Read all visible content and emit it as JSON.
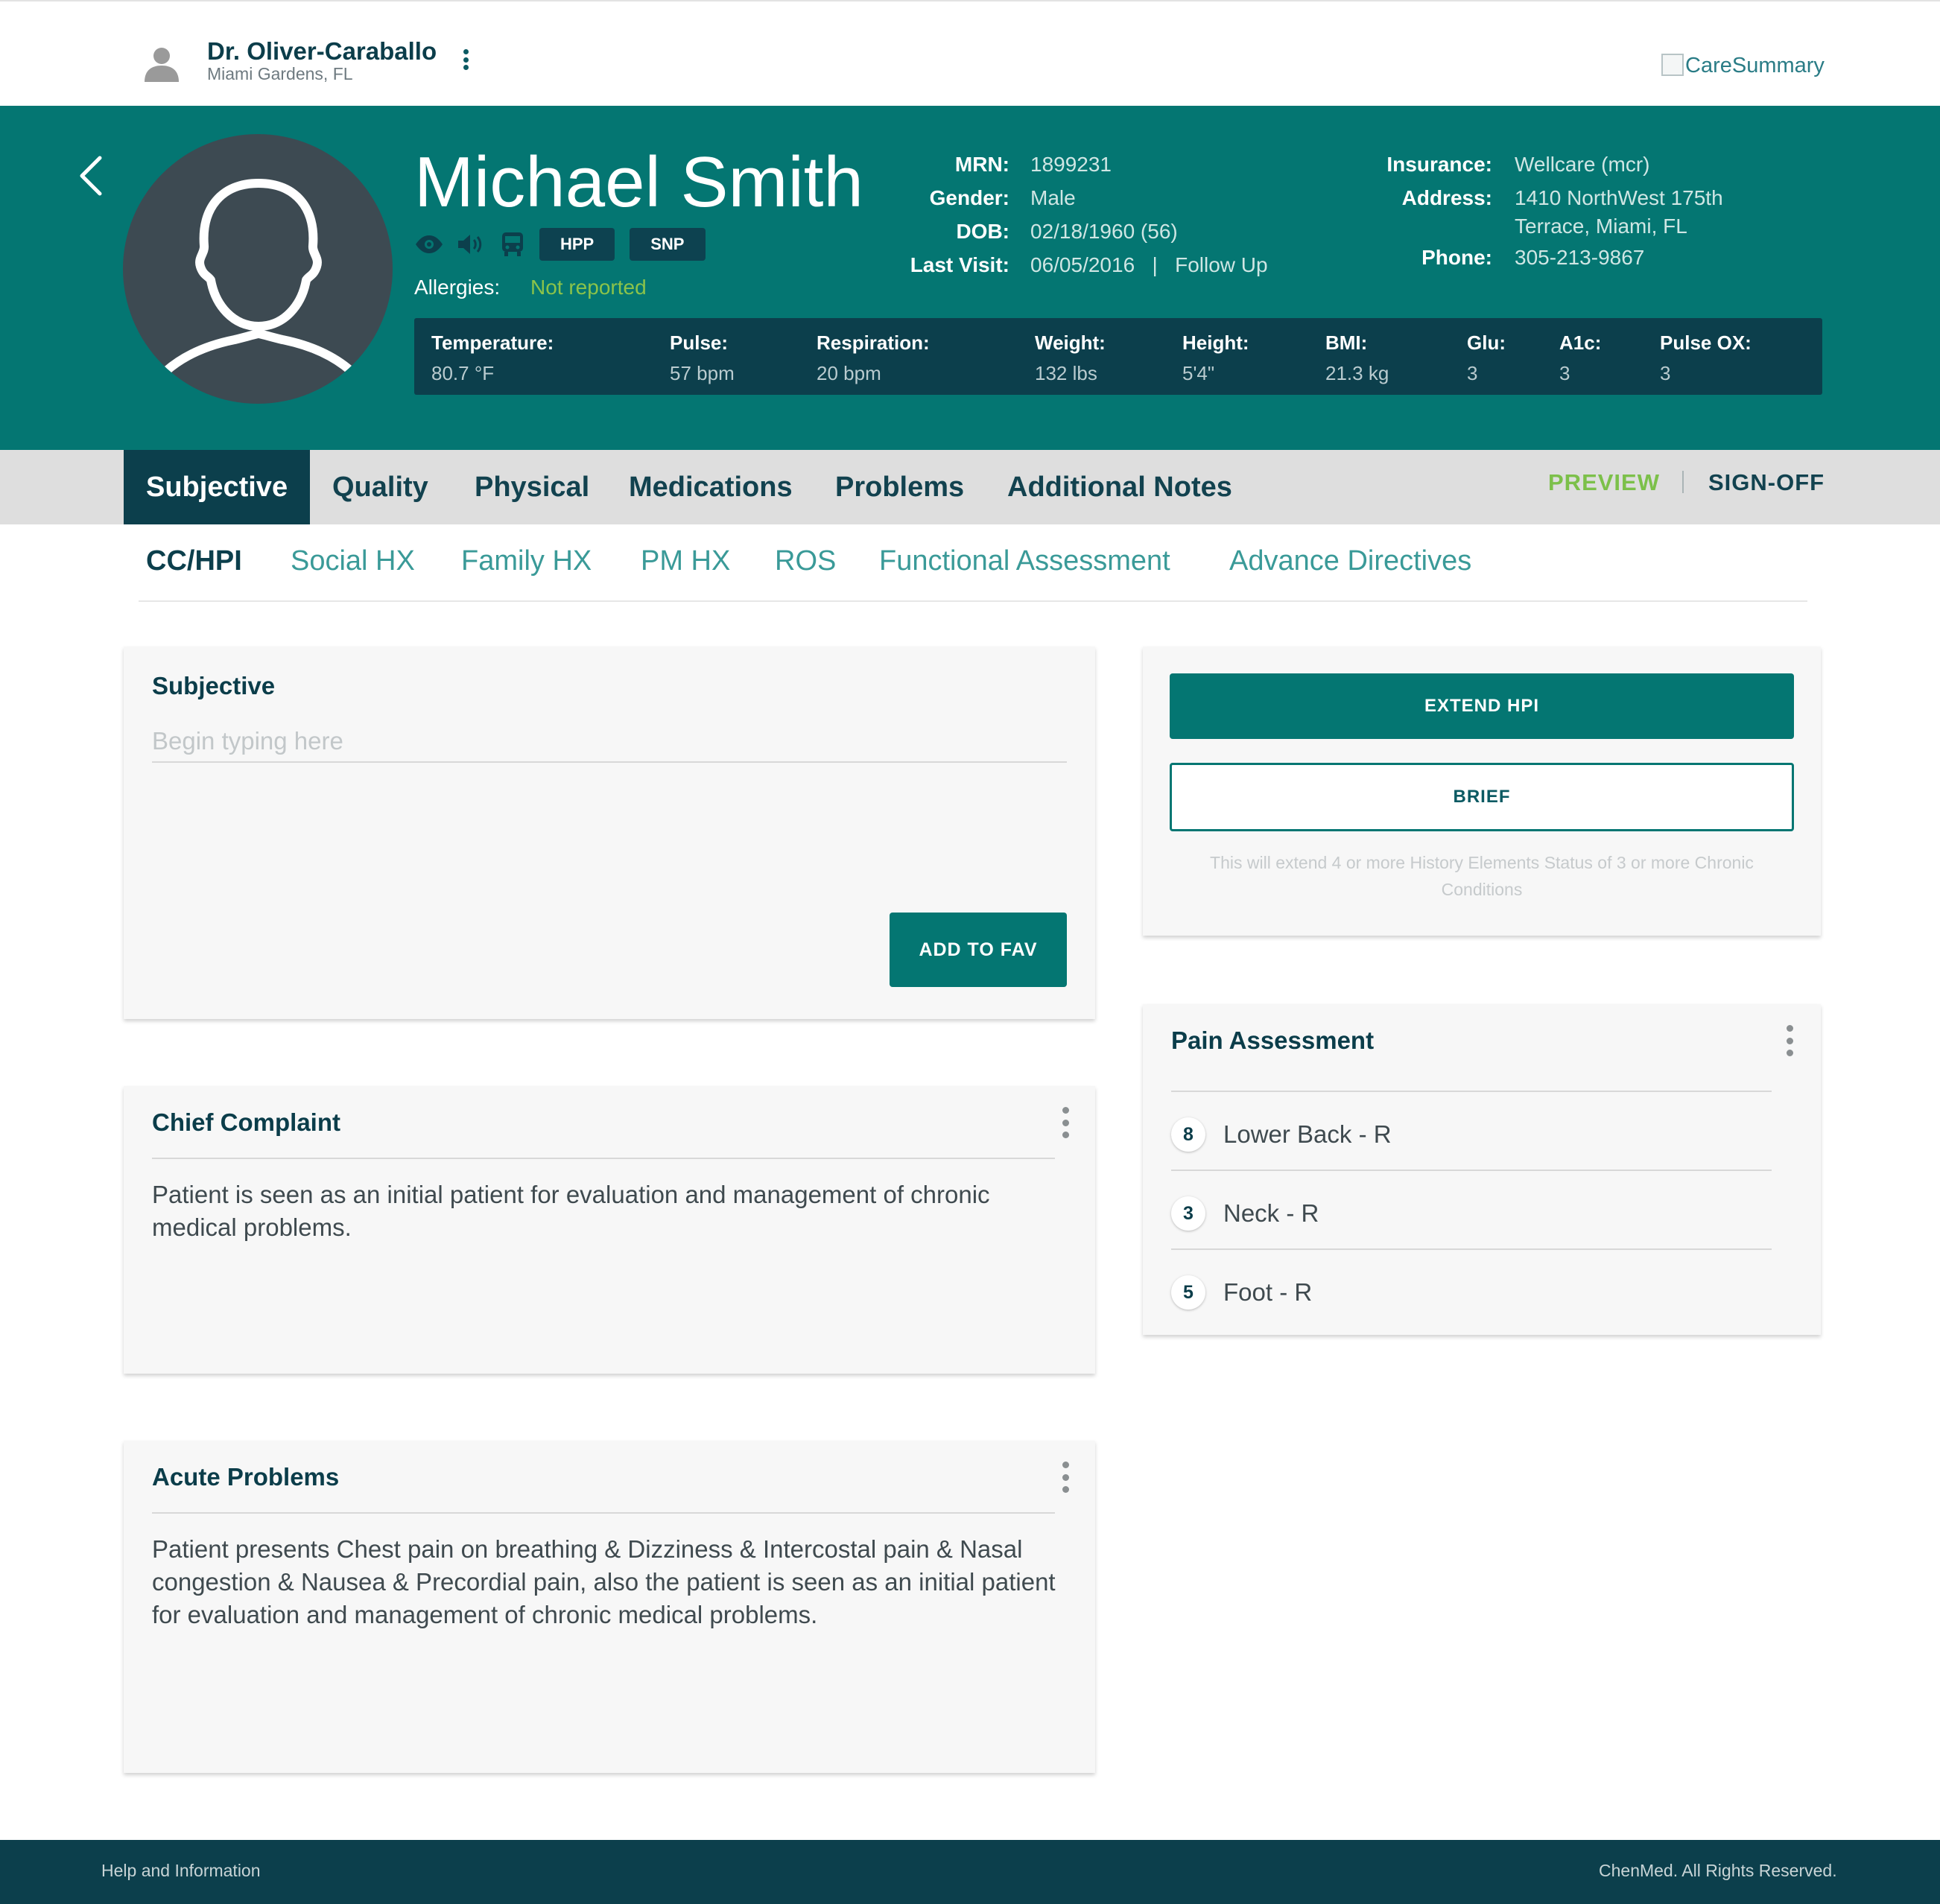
{
  "header": {
    "doctor_name": "Dr. Oliver-Caraballo",
    "doctor_location": "Miami Gardens, FL",
    "brand": "CareSummary"
  },
  "patient": {
    "name": "Michael Smith",
    "tags": [
      "HPP",
      "SNP"
    ],
    "icons": [
      "eye-icon",
      "volume-icon",
      "bus-icon"
    ],
    "allergies_label": "Allergies:",
    "allergies_value": "Not reported",
    "info_left": [
      {
        "label": "MRN:",
        "value": "1899231"
      },
      {
        "label": "Gender:",
        "value": "Male"
      },
      {
        "label": "DOB:",
        "value": "02/18/1960 (56)"
      },
      {
        "label": "Last Visit:",
        "value": "06/05/2016   |   Follow Up"
      }
    ],
    "info_right": [
      {
        "label": "Insurance:",
        "value": "Wellcare (mcr)"
      },
      {
        "label": "Address:",
        "value_line1": "1410 NorthWest 175th",
        "value_line2": "Terrace, Miami, FL"
      },
      {
        "label": "Phone:",
        "value": "305-213-9867"
      }
    ],
    "vitals": [
      {
        "label": "Temperature:",
        "value": "80.7 °F"
      },
      {
        "label": "Pulse:",
        "value": "57 bpm"
      },
      {
        "label": "Respiration:",
        "value": "20 bpm"
      },
      {
        "label": "Weight:",
        "value": "132 lbs"
      },
      {
        "label": "Height:",
        "value": "5'4\""
      },
      {
        "label": "BMI:",
        "value": "21.3 kg"
      },
      {
        "label": "Glu:",
        "value": "3"
      },
      {
        "label": "A1c:",
        "value": "3"
      },
      {
        "label": "Pulse OX:",
        "value": "3"
      }
    ]
  },
  "tabs": {
    "main": [
      "Subjective",
      "Quality",
      "Physical",
      "Medications",
      "Problems",
      "Additional Notes"
    ],
    "active_main": "Subjective",
    "preview": "PREVIEW",
    "signoff": "SIGN-OFF",
    "sub": [
      "CC/HPI",
      "Social HX",
      "Family HX",
      "PM HX",
      "ROS",
      "Functional Assessment",
      "Advance Directives"
    ],
    "active_sub": "CC/HPI"
  },
  "subjective_card": {
    "title": "Subjective",
    "placeholder": "Begin typing here",
    "value": "",
    "fav_button": "ADD TO FAV"
  },
  "hpi_card": {
    "extend_button": "EXTEND HPI",
    "brief_button": "BRIEF",
    "note": "This will extend 4 or more History Elements Status of 3 or more Chronic Conditions"
  },
  "chief_complaint": {
    "title": "Chief Complaint",
    "text": "Patient is seen as an initial patient for evaluation and management of chronic medical problems."
  },
  "acute_problems": {
    "title": "Acute Problems",
    "text": "Patient presents Chest pain on breathing & Dizziness & Intercostal pain & Nasal congestion & Nausea & Precordial pain, also the patient is seen as an initial patient for evaluation and management of chronic medical problems."
  },
  "pain_assessment": {
    "title": "Pain Assessment",
    "items": [
      {
        "score": "8",
        "label": "Lower Back - R"
      },
      {
        "score": "3",
        "label": "Neck - R"
      },
      {
        "score": "5",
        "label": "Foot - R"
      }
    ]
  },
  "footer": {
    "help": "Help and Information",
    "copyright": "ChenMed. All Rights Reserved."
  },
  "colors": {
    "teal": "#047672",
    "navy": "#0c3f4c",
    "green": "#8bc34a",
    "tab_bg": "#dedede"
  }
}
